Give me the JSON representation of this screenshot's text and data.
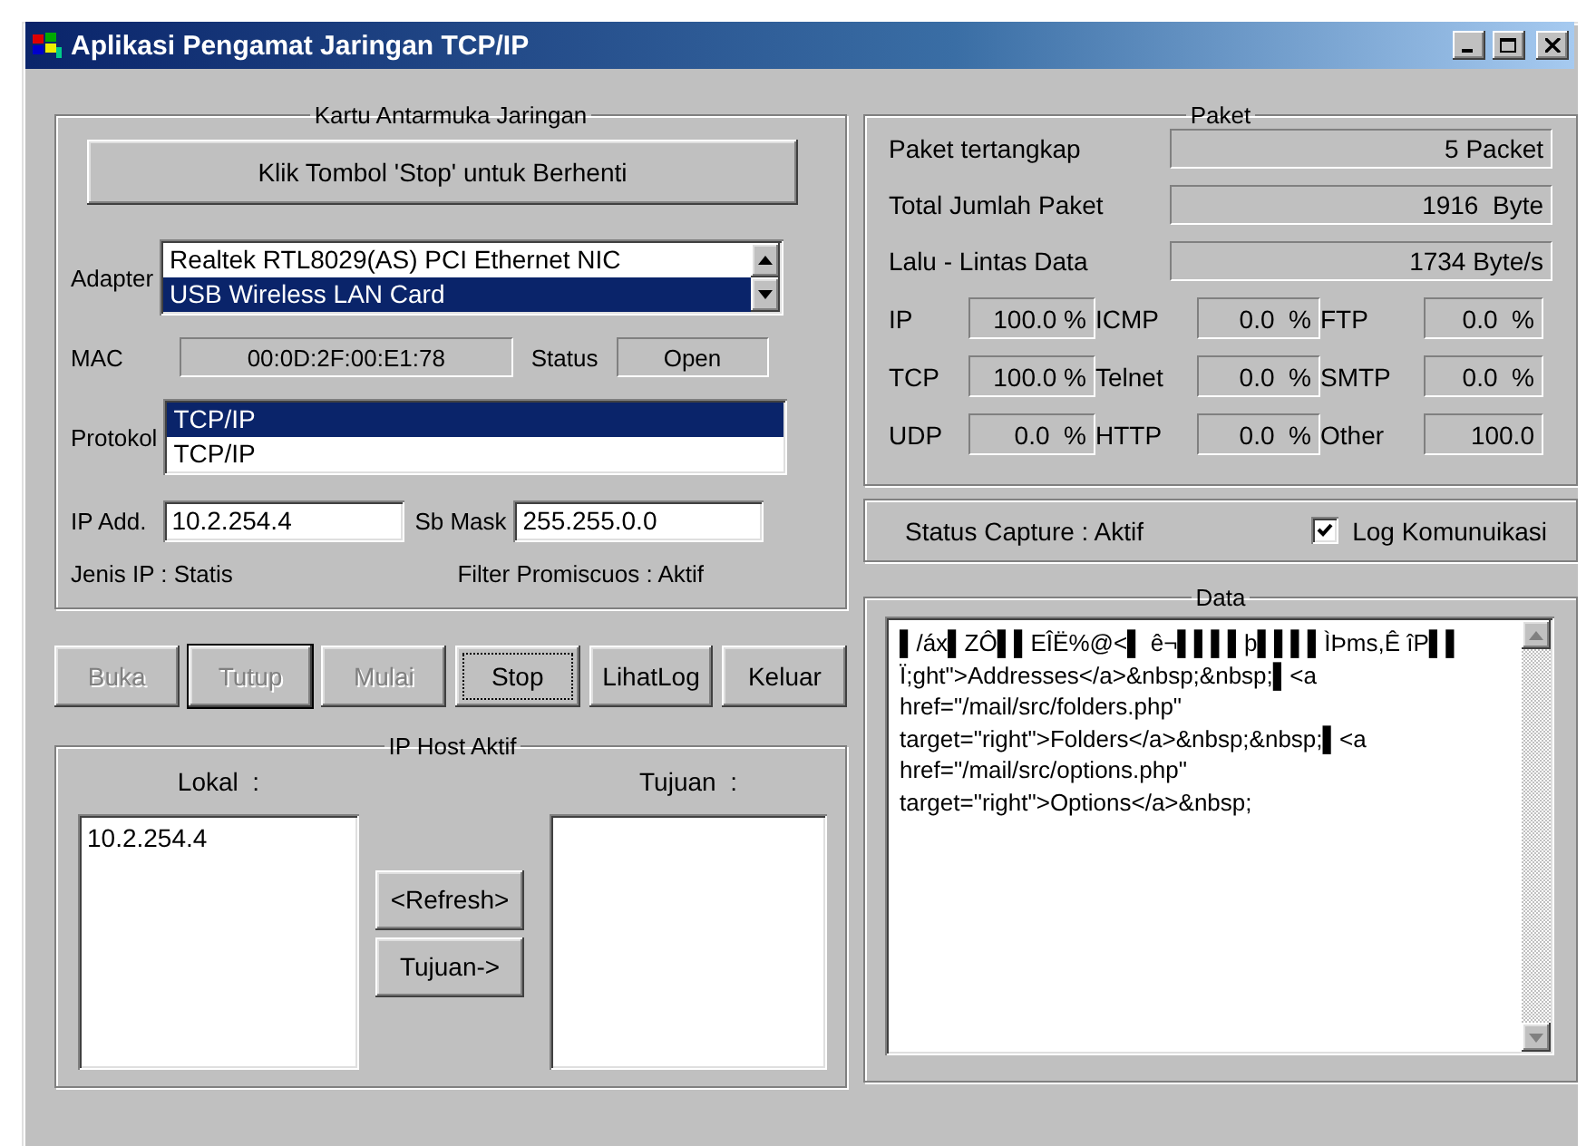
{
  "window": {
    "title": "Aplikasi Pengamat Jaringan TCP/IP"
  },
  "interface_card": {
    "title": "Kartu Antarmuka Jaringan",
    "notice": "Klik Tombol 'Stop' untuk Berhenti",
    "adapter": {
      "label": "Adapter",
      "items": [
        {
          "text": "Realtek RTL8029(AS) PCI Ethernet NIC",
          "selected": false
        },
        {
          "text": "USB Wireless LAN Card",
          "selected": true
        }
      ]
    },
    "mac": {
      "label": "MAC",
      "value": "00:0D:2F:00:E1:78"
    },
    "status": {
      "label": "Status",
      "value": "Open"
    },
    "protocol": {
      "label": "Protokol",
      "items": [
        {
          "text": "TCP/IP",
          "selected": true
        },
        {
          "text": "TCP/IP",
          "selected": false
        }
      ]
    },
    "ip": {
      "label": "IP Add.",
      "value": "10.2.254.4"
    },
    "mask": {
      "label": "Sb Mask",
      "value": "255.255.0.0"
    },
    "ip_type": "Jenis IP : Statis",
    "promiscuous": "Filter Promiscuos : Aktif"
  },
  "buttons": [
    {
      "label": "Buka",
      "disabled": true,
      "default": false,
      "focused": false
    },
    {
      "label": "Tutup",
      "disabled": true,
      "default": true,
      "focused": false
    },
    {
      "label": "Mulai",
      "disabled": true,
      "default": false,
      "focused": false
    },
    {
      "label": "Stop",
      "disabled": false,
      "default": false,
      "focused": true
    },
    {
      "label": "LihatLog",
      "disabled": false,
      "default": false,
      "focused": false
    },
    {
      "label": "Keluar",
      "disabled": false,
      "default": false,
      "focused": false
    }
  ],
  "ip_hosts": {
    "title": "IP Host Aktif",
    "local": {
      "label": "Lokal  :",
      "items": [
        "10.2.254.4"
      ]
    },
    "dest": {
      "label": "Tujuan  :"
    },
    "buttons": [
      "<Refresh>",
      "Tujuan->"
    ]
  },
  "packets": {
    "title": "Paket",
    "rows": [
      {
        "label": "Paket tertangkap",
        "value": "5 Packet"
      },
      {
        "label": "Total Jumlah Paket",
        "value": "1916  Byte"
      },
      {
        "label": "Lalu - Lintas Data",
        "value": "1734 Byte/s"
      }
    ],
    "protocols": [
      {
        "label": "IP",
        "value": "100.0 %"
      },
      {
        "label": "ICMP",
        "value": "0.0  %"
      },
      {
        "label": "FTP",
        "value": "0.0  %"
      },
      {
        "label": "TCP",
        "value": "100.0 %"
      },
      {
        "label": "Telnet",
        "value": "0.0  %"
      },
      {
        "label": "SMTP",
        "value": "0.0  %"
      },
      {
        "label": "UDP",
        "value": "0.0  %"
      },
      {
        "label": "HTTP",
        "value": "0.0  %"
      },
      {
        "label": "Other",
        "value": "100.0"
      }
    ]
  },
  "capture": {
    "status": "Status Capture : Aktif",
    "log": {
      "label": "Log Komunuikasi",
      "checked": true
    }
  },
  "data": {
    "title": "Data",
    "lines": [
      "▌/áx▌ZÔ▌▌EÎË%@<▌ ê¬▌▌▌▌þ▌▌▌▌ÌÞms,Ê îP▌▌",
      "Ï;ght\">Addresses</a>&nbsp;&nbsp;▌<a",
      "href=\"/mail/src/folders.php\"",
      "target=\"right\">Folders</a>&nbsp;&nbsp;▌<a",
      "href=\"/mail/src/options.php\"",
      "target=\"right\">Options</a>&nbsp;"
    ]
  }
}
